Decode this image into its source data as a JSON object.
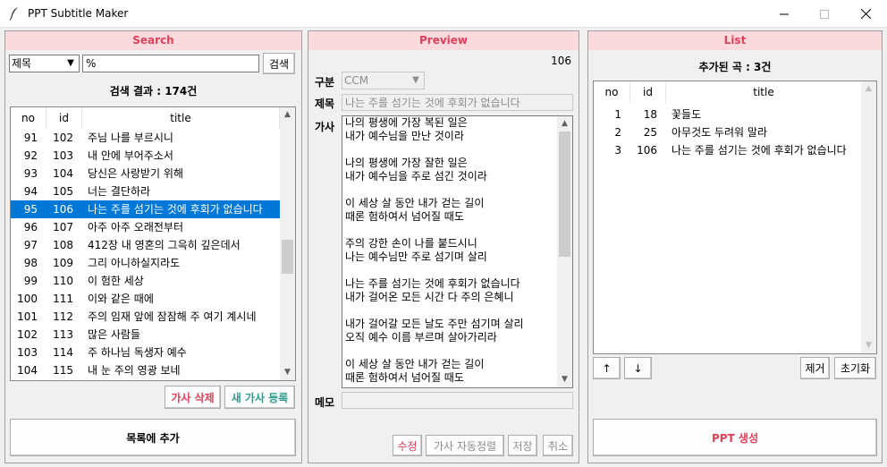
{
  "window": {
    "title": "PPT Subtitle Maker"
  },
  "search": {
    "header": "Search",
    "field_selected": "제목",
    "query": "%",
    "search_button": "검색",
    "result_label": "검색 결과 : 174건",
    "columns": [
      "no",
      "id",
      "title"
    ],
    "rows": [
      {
        "no": "91",
        "id": "102",
        "title": "주님 나를 부르시니"
      },
      {
        "no": "92",
        "id": "103",
        "title": "내 안에 부어주소서"
      },
      {
        "no": "93",
        "id": "104",
        "title": "당신은 사랑받기 위해"
      },
      {
        "no": "94",
        "id": "105",
        "title": "너는 결단하라"
      },
      {
        "no": "95",
        "id": "106",
        "title": "나는 주를 섬기는 것에 후회가 없습니다"
      },
      {
        "no": "96",
        "id": "107",
        "title": "아주 아주 오래전부터"
      },
      {
        "no": "97",
        "id": "108",
        "title": "412장 내 영혼의 그윽히 깊은데서"
      },
      {
        "no": "98",
        "id": "109",
        "title": "그리 아니하실지라도"
      },
      {
        "no": "99",
        "id": "110",
        "title": "이 험한 세상"
      },
      {
        "no": "100",
        "id": "111",
        "title": "이와 같은 때에"
      },
      {
        "no": "101",
        "id": "112",
        "title": "주의 임재 앞에 잠잠해 주 여기 계시네"
      },
      {
        "no": "102",
        "id": "113",
        "title": "많은 사람들"
      },
      {
        "no": "103",
        "id": "114",
        "title": "주 하나님 독생자 예수"
      },
      {
        "no": "104",
        "id": "115",
        "title": "내 눈 주의 영광 보네"
      }
    ],
    "delete_button": "가사 삭제",
    "new_button": "새 가사 등록",
    "add_button": "목록에 추가"
  },
  "preview": {
    "header": "Preview",
    "id_value": "106",
    "category_label": "구분",
    "category_value": "CCM",
    "title_label": "제목",
    "title_value": "나는 주를 섬기는 것에 후회가 없습니다",
    "lyrics_label": "가사",
    "lyrics": [
      "나의 평생에 가장 복된 일은",
      "내가 예수님을 만난 것이라",
      "",
      "나의 평생에 가장 잘한 일은",
      "내가 예수님을 주로 섬긴 것이라",
      "",
      "이 세상 살 동안 내가 걷는 길이",
      "때론 험하여서 넘어질 때도",
      "",
      "주의 강한 손이 나를 붙드시니",
      "나는 예수님만 주로 섬기며 살리",
      "",
      "나는 주를 섬기는 것에 후회가 없습니다",
      "내가 걸어온 모든 시간 다 주의 은혜니",
      "",
      "내가 걸어갈 모든 날도 주만 섬기며 살리",
      "오직 예수 이름 부르며 살아가리라",
      "",
      "이 세상 살 동안 내가 걷는 길이",
      "때론 험하여서 넘어질 때도"
    ],
    "memo_label": "메모",
    "memo_value": "",
    "edit_button": "수정",
    "autoalign_button": "가사 자동정렬",
    "save_button": "저장",
    "cancel_button": "취소"
  },
  "list": {
    "header": "List",
    "count_label": "추가된 곡 : 3건",
    "columns": [
      "no",
      "id",
      "title"
    ],
    "rows": [
      {
        "no": "1",
        "id": "18",
        "title": "꽃들도"
      },
      {
        "no": "2",
        "id": "25",
        "title": "아무것도 두려워 말라"
      },
      {
        "no": "3",
        "id": "106",
        "title": "나는 주를 섬기는 것에 후회가 없습니다"
      }
    ],
    "up_button": "↑",
    "down_button": "↓",
    "remove_button": "제거",
    "reset_button": "초기화",
    "generate_button": "PPT 생성"
  },
  "colors": {
    "header_bg": "#fadadd",
    "header_text": "#e0405a",
    "selection": "#0078d7",
    "teal": "#2a9d8f"
  }
}
